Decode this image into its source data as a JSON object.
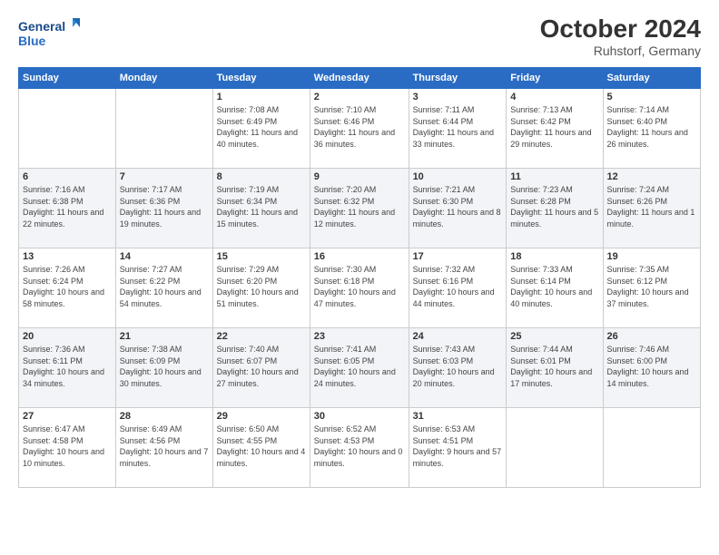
{
  "logo": {
    "line1": "General",
    "line2": "Blue"
  },
  "header": {
    "title": "October 2024",
    "subtitle": "Ruhstorf, Germany"
  },
  "days_of_week": [
    "Sunday",
    "Monday",
    "Tuesday",
    "Wednesday",
    "Thursday",
    "Friday",
    "Saturday"
  ],
  "weeks": [
    [
      {
        "day": "",
        "detail": ""
      },
      {
        "day": "",
        "detail": ""
      },
      {
        "day": "1",
        "detail": "Sunrise: 7:08 AM\nSunset: 6:49 PM\nDaylight: 11 hours and 40 minutes."
      },
      {
        "day": "2",
        "detail": "Sunrise: 7:10 AM\nSunset: 6:46 PM\nDaylight: 11 hours and 36 minutes."
      },
      {
        "day": "3",
        "detail": "Sunrise: 7:11 AM\nSunset: 6:44 PM\nDaylight: 11 hours and 33 minutes."
      },
      {
        "day": "4",
        "detail": "Sunrise: 7:13 AM\nSunset: 6:42 PM\nDaylight: 11 hours and 29 minutes."
      },
      {
        "day": "5",
        "detail": "Sunrise: 7:14 AM\nSunset: 6:40 PM\nDaylight: 11 hours and 26 minutes."
      }
    ],
    [
      {
        "day": "6",
        "detail": "Sunrise: 7:16 AM\nSunset: 6:38 PM\nDaylight: 11 hours and 22 minutes."
      },
      {
        "day": "7",
        "detail": "Sunrise: 7:17 AM\nSunset: 6:36 PM\nDaylight: 11 hours and 19 minutes."
      },
      {
        "day": "8",
        "detail": "Sunrise: 7:19 AM\nSunset: 6:34 PM\nDaylight: 11 hours and 15 minutes."
      },
      {
        "day": "9",
        "detail": "Sunrise: 7:20 AM\nSunset: 6:32 PM\nDaylight: 11 hours and 12 minutes."
      },
      {
        "day": "10",
        "detail": "Sunrise: 7:21 AM\nSunset: 6:30 PM\nDaylight: 11 hours and 8 minutes."
      },
      {
        "day": "11",
        "detail": "Sunrise: 7:23 AM\nSunset: 6:28 PM\nDaylight: 11 hours and 5 minutes."
      },
      {
        "day": "12",
        "detail": "Sunrise: 7:24 AM\nSunset: 6:26 PM\nDaylight: 11 hours and 1 minute."
      }
    ],
    [
      {
        "day": "13",
        "detail": "Sunrise: 7:26 AM\nSunset: 6:24 PM\nDaylight: 10 hours and 58 minutes."
      },
      {
        "day": "14",
        "detail": "Sunrise: 7:27 AM\nSunset: 6:22 PM\nDaylight: 10 hours and 54 minutes."
      },
      {
        "day": "15",
        "detail": "Sunrise: 7:29 AM\nSunset: 6:20 PM\nDaylight: 10 hours and 51 minutes."
      },
      {
        "day": "16",
        "detail": "Sunrise: 7:30 AM\nSunset: 6:18 PM\nDaylight: 10 hours and 47 minutes."
      },
      {
        "day": "17",
        "detail": "Sunrise: 7:32 AM\nSunset: 6:16 PM\nDaylight: 10 hours and 44 minutes."
      },
      {
        "day": "18",
        "detail": "Sunrise: 7:33 AM\nSunset: 6:14 PM\nDaylight: 10 hours and 40 minutes."
      },
      {
        "day": "19",
        "detail": "Sunrise: 7:35 AM\nSunset: 6:12 PM\nDaylight: 10 hours and 37 minutes."
      }
    ],
    [
      {
        "day": "20",
        "detail": "Sunrise: 7:36 AM\nSunset: 6:11 PM\nDaylight: 10 hours and 34 minutes."
      },
      {
        "day": "21",
        "detail": "Sunrise: 7:38 AM\nSunset: 6:09 PM\nDaylight: 10 hours and 30 minutes."
      },
      {
        "day": "22",
        "detail": "Sunrise: 7:40 AM\nSunset: 6:07 PM\nDaylight: 10 hours and 27 minutes."
      },
      {
        "day": "23",
        "detail": "Sunrise: 7:41 AM\nSunset: 6:05 PM\nDaylight: 10 hours and 24 minutes."
      },
      {
        "day": "24",
        "detail": "Sunrise: 7:43 AM\nSunset: 6:03 PM\nDaylight: 10 hours and 20 minutes."
      },
      {
        "day": "25",
        "detail": "Sunrise: 7:44 AM\nSunset: 6:01 PM\nDaylight: 10 hours and 17 minutes."
      },
      {
        "day": "26",
        "detail": "Sunrise: 7:46 AM\nSunset: 6:00 PM\nDaylight: 10 hours and 14 minutes."
      }
    ],
    [
      {
        "day": "27",
        "detail": "Sunrise: 6:47 AM\nSunset: 4:58 PM\nDaylight: 10 hours and 10 minutes."
      },
      {
        "day": "28",
        "detail": "Sunrise: 6:49 AM\nSunset: 4:56 PM\nDaylight: 10 hours and 7 minutes."
      },
      {
        "day": "29",
        "detail": "Sunrise: 6:50 AM\nSunset: 4:55 PM\nDaylight: 10 hours and 4 minutes."
      },
      {
        "day": "30",
        "detail": "Sunrise: 6:52 AM\nSunset: 4:53 PM\nDaylight: 10 hours and 0 minutes."
      },
      {
        "day": "31",
        "detail": "Sunrise: 6:53 AM\nSunset: 4:51 PM\nDaylight: 9 hours and 57 minutes."
      },
      {
        "day": "",
        "detail": ""
      },
      {
        "day": "",
        "detail": ""
      }
    ]
  ]
}
